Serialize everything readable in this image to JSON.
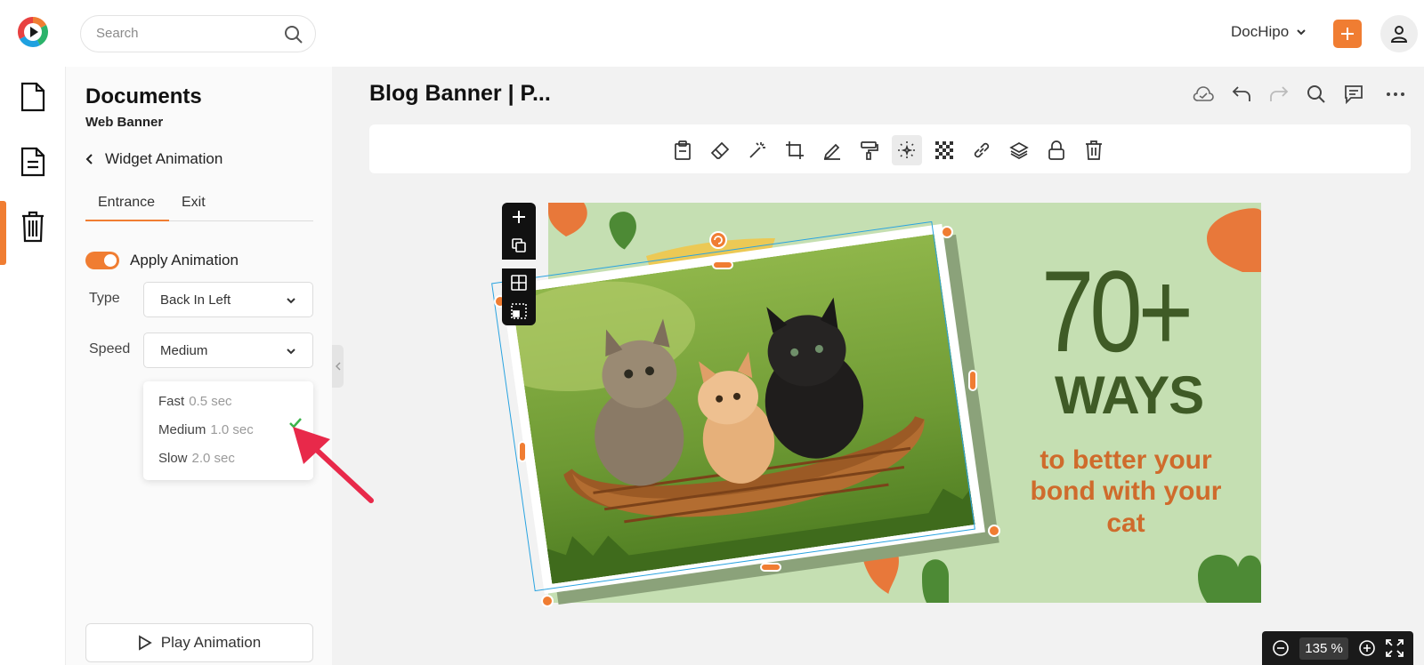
{
  "app": {
    "account_name": "DocHipo",
    "brand_color": "#f07d32"
  },
  "search": {
    "placeholder": "Search"
  },
  "panel": {
    "title": "Documents",
    "subtitle": "Web Banner",
    "back_label": "Widget Animation",
    "tabs": [
      {
        "label": "Entrance",
        "active": true
      },
      {
        "label": "Exit",
        "active": false
      }
    ],
    "apply_animation": {
      "label": "Apply Animation",
      "enabled": true
    },
    "type": {
      "label": "Type",
      "value": "Back In Left"
    },
    "speed": {
      "label": "Speed",
      "value": "Medium",
      "options": [
        {
          "label": "Fast",
          "duration": "0.5 sec",
          "selected": false
        },
        {
          "label": "Medium",
          "duration": "1.0 sec",
          "selected": true
        },
        {
          "label": "Slow",
          "duration": "2.0 sec",
          "selected": false
        }
      ]
    },
    "play_label": "Play Animation"
  },
  "document": {
    "title": "Blog Banner | P..."
  },
  "canvas": {
    "headline_number": "70+",
    "headline_word": "WAYS",
    "subheading_line1": "to better your",
    "subheading_line2": "bond with your",
    "subheading_line3": "cat",
    "background_color": "#c5dfb2",
    "headline_color": "#3f5b26",
    "subheading_color": "#cf6b2c"
  },
  "zoom": {
    "value": "135 %"
  },
  "icons": {
    "rail": [
      "file-icon",
      "document-icon",
      "trash-icon"
    ],
    "actions": [
      "cloud-saved-icon",
      "undo-icon",
      "redo-icon",
      "search-icon",
      "comment-icon",
      "more-icon"
    ],
    "toolbar": [
      "clipboard-icon",
      "eraser-icon",
      "magic-wand-icon",
      "crop-icon",
      "pen-icon",
      "paint-roller-icon",
      "animation-icon",
      "transparency-icon",
      "link-icon",
      "layers-icon",
      "lock-icon",
      "delete-icon"
    ]
  }
}
